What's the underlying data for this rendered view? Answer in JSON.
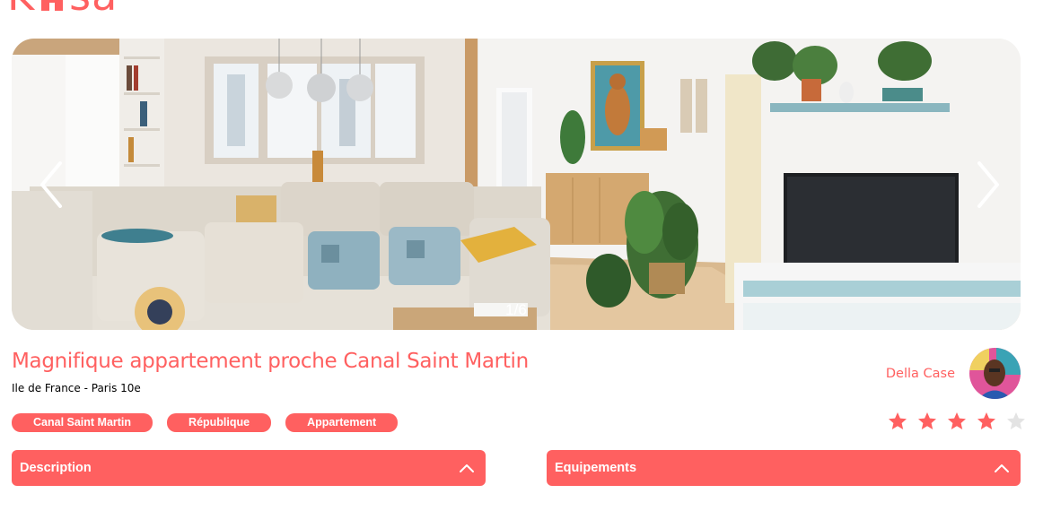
{
  "brand": {
    "logo_text_left": "K",
    "logo_text_right": "sa",
    "accent_color": "#FF6060"
  },
  "gallery": {
    "counter": "1/6",
    "prev_icon": "chevron-left-icon",
    "next_icon": "chevron-right-icon"
  },
  "listing": {
    "title": "Magnifique appartement proche Canal Saint Martin",
    "location": "Ile de France - Paris 10e",
    "tags": [
      "Canal Saint Martin",
      "République",
      "Appartement"
    ]
  },
  "host": {
    "name": "Della Case"
  },
  "rating": {
    "value": 4,
    "max": 5,
    "filled_color": "#FF6060",
    "empty_color": "#E3E3E3"
  },
  "collapses": {
    "description": {
      "title": "Description",
      "icon": "chevron-up-icon"
    },
    "equipements": {
      "title": "Equipements",
      "icon": "chevron-up-icon"
    }
  }
}
